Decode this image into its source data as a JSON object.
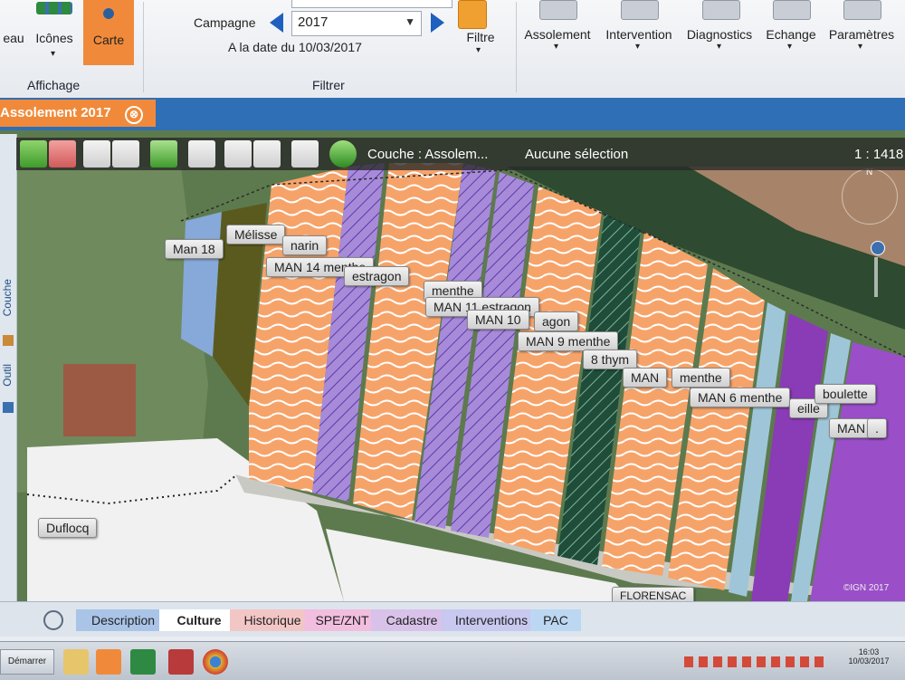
{
  "ribbon": {
    "affichage": {
      "tableau_label": "eau",
      "icones_label": "Icônes",
      "carte_label": "Carte",
      "group_label": "Affichage"
    },
    "filtres": {
      "campagne_label": "Campagne",
      "campagne_value": "2017",
      "date_text": "A la date du 10/03/2017",
      "filtre_label": "Filtre",
      "group_label": "Filtrer"
    },
    "menus": [
      "Assolement",
      "Intervention",
      "Diagnostics",
      "Echange",
      "Paramètres"
    ]
  },
  "doc_tab": {
    "label": "Assolement 2017",
    "close_glyph": "⊗"
  },
  "left_rail": {
    "couche": "Couche",
    "outil": "Outil"
  },
  "map_toolbar": {
    "layer_text": "Couche : Assolem...",
    "selection_text": "Aucune sélection",
    "scale_text": "1 : 1418",
    "north_label": "N"
  },
  "map_labels": [
    "Man 18",
    "Mélisse",
    "narin",
    "MAN 14 menthe",
    "estragon",
    "menthe",
    "MAN 11 estragon",
    "MAN 10",
    "agon",
    "MAN 9 menthe",
    "8 thym",
    "MAN",
    "menthe",
    "MAN 6 menthe",
    "eille",
    "boulette",
    "MAN 2",
    "."
  ],
  "place_labels": {
    "duflocq": "Duflocq",
    "florensac": "FLORENSAC"
  },
  "copyright": "©IGN 2017",
  "bottom_tabs": [
    {
      "label": "Description",
      "color": "#aac4e8"
    },
    {
      "label": "Culture",
      "color": "#ffffff"
    },
    {
      "label": "Historique",
      "color": "#f3c6c6"
    },
    {
      "label": "SPE/ZNT",
      "color": "#f2bedf"
    },
    {
      "label": "Cadastre",
      "color": "#d9c2ea"
    },
    {
      "label": "Interventions",
      "color": "#c8c8f0"
    },
    {
      "label": "PAC",
      "color": "#bcd7f2"
    }
  ],
  "taskbar": {
    "start_label": "Démarrer",
    "clock_time": "16:03",
    "clock_date": "10/03/2017"
  }
}
